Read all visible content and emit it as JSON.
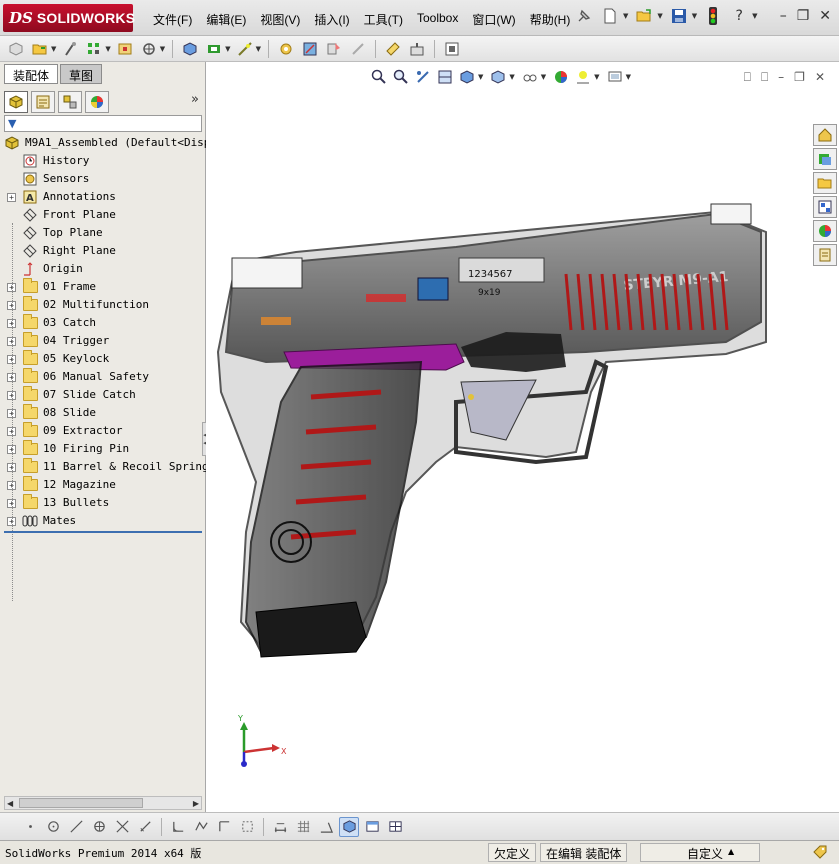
{
  "app": {
    "logo_ds": "DS",
    "logo_text": "SOLIDWORKS"
  },
  "menu": [
    {
      "label": "文件(F)"
    },
    {
      "label": "编辑(E)"
    },
    {
      "label": "视图(V)"
    },
    {
      "label": "插入(I)"
    },
    {
      "label": "工具(T)"
    },
    {
      "label": "Toolbox"
    },
    {
      "label": "窗口(W)"
    },
    {
      "label": "帮助(H)"
    }
  ],
  "panel_tabs": {
    "assembly": "装配体",
    "sketch": "草图"
  },
  "tree": {
    "root": "M9A1_Assembled  (Default<Displ",
    "items": [
      {
        "label": "History",
        "icon": "history-icon",
        "expandable": false
      },
      {
        "label": "Sensors",
        "icon": "sensors-icon",
        "expandable": false
      },
      {
        "label": "Annotations",
        "icon": "annotations-icon",
        "expandable": true
      },
      {
        "label": "Front Plane",
        "icon": "plane-icon",
        "expandable": false
      },
      {
        "label": "Top Plane",
        "icon": "plane-icon",
        "expandable": false
      },
      {
        "label": "Right Plane",
        "icon": "plane-icon",
        "expandable": false
      },
      {
        "label": "Origin",
        "icon": "origin-icon",
        "expandable": false
      },
      {
        "label": "01 Frame",
        "icon": "folder-icon",
        "expandable": true
      },
      {
        "label": "02 Multifunction",
        "icon": "folder-icon",
        "expandable": true
      },
      {
        "label": "03 Catch",
        "icon": "folder-icon",
        "expandable": true
      },
      {
        "label": "04 Trigger",
        "icon": "folder-icon",
        "expandable": true
      },
      {
        "label": "05 Keylock",
        "icon": "folder-icon",
        "expandable": true
      },
      {
        "label": "06 Manual Safety",
        "icon": "folder-icon",
        "expandable": true
      },
      {
        "label": "07 Slide Catch",
        "icon": "folder-icon",
        "expandable": true
      },
      {
        "label": "08 Slide",
        "icon": "folder-icon",
        "expandable": true
      },
      {
        "label": "09 Extractor",
        "icon": "folder-icon",
        "expandable": true
      },
      {
        "label": "10 Firing Pin",
        "icon": "folder-icon",
        "expandable": true
      },
      {
        "label": "11 Barrel & Recoil Spring",
        "icon": "folder-icon",
        "expandable": true
      },
      {
        "label": "12 Magazine",
        "icon": "folder-icon",
        "expandable": true
      },
      {
        "label": "13 Bullets",
        "icon": "folder-icon",
        "expandable": true
      },
      {
        "label": "Mates",
        "icon": "mates-icon",
        "expandable": true
      }
    ]
  },
  "viewport": {
    "model_text_serial": "1234567",
    "model_text_caliber": "9x19",
    "model_text_brand": "STEYR M9-A1",
    "triad_x": "X",
    "triad_y": "Y"
  },
  "status": {
    "product": "SolidWorks Premium 2014 x64 版",
    "undefined": "欠定义",
    "editing": "在编辑 装配体",
    "custom": "自定义"
  },
  "colors": {
    "logo_red": "#c8102e",
    "accent_blue": "#3d6fb0",
    "magazine_red": "#b01818",
    "trigger_purple": "#9b1e9b"
  }
}
